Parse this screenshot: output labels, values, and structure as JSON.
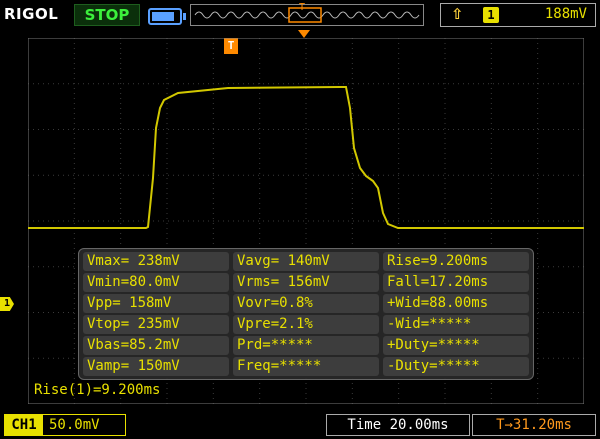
{
  "header": {
    "brand": "RIGOL",
    "run_state": "STOP",
    "memory_marker": "T",
    "trigger": {
      "edge_icon": "rising-edge-icon",
      "channel": "1",
      "level": "188mV"
    }
  },
  "display": {
    "trigger_marker": "T",
    "channel_marker": "1",
    "colors": {
      "trace": "#d2c800",
      "grid": "#3a3a3a",
      "accent": "#e8e000",
      "trigger": "#ff8a00"
    }
  },
  "measurements": [
    [
      "Vmax= 238mV",
      "Vavg= 140mV",
      "Rise=9.200ms"
    ],
    [
      "Vmin=80.0mV",
      "Vrms= 156mV",
      "Fall=17.20ms"
    ],
    [
      "Vpp= 158mV",
      "Vovr=0.8%",
      "+Wid=88.00ms"
    ],
    [
      "Vtop= 235mV",
      "Vpre=2.1%",
      "-Wid=*****"
    ],
    [
      "Vbas=85.2mV",
      "Prd=*****",
      "+Duty=*****"
    ],
    [
      "Vamp= 150mV",
      "Freq=*****",
      "-Duty=*****"
    ]
  ],
  "readout": "Rise(1)=9.200ms",
  "footer": {
    "channel_label": "CH1",
    "coupling_icon": "dc-coupling-icon",
    "channel_scale": "50.0mV",
    "timebase": "Time 20.00ms",
    "trigger_offset": "T→31.20ms"
  }
}
